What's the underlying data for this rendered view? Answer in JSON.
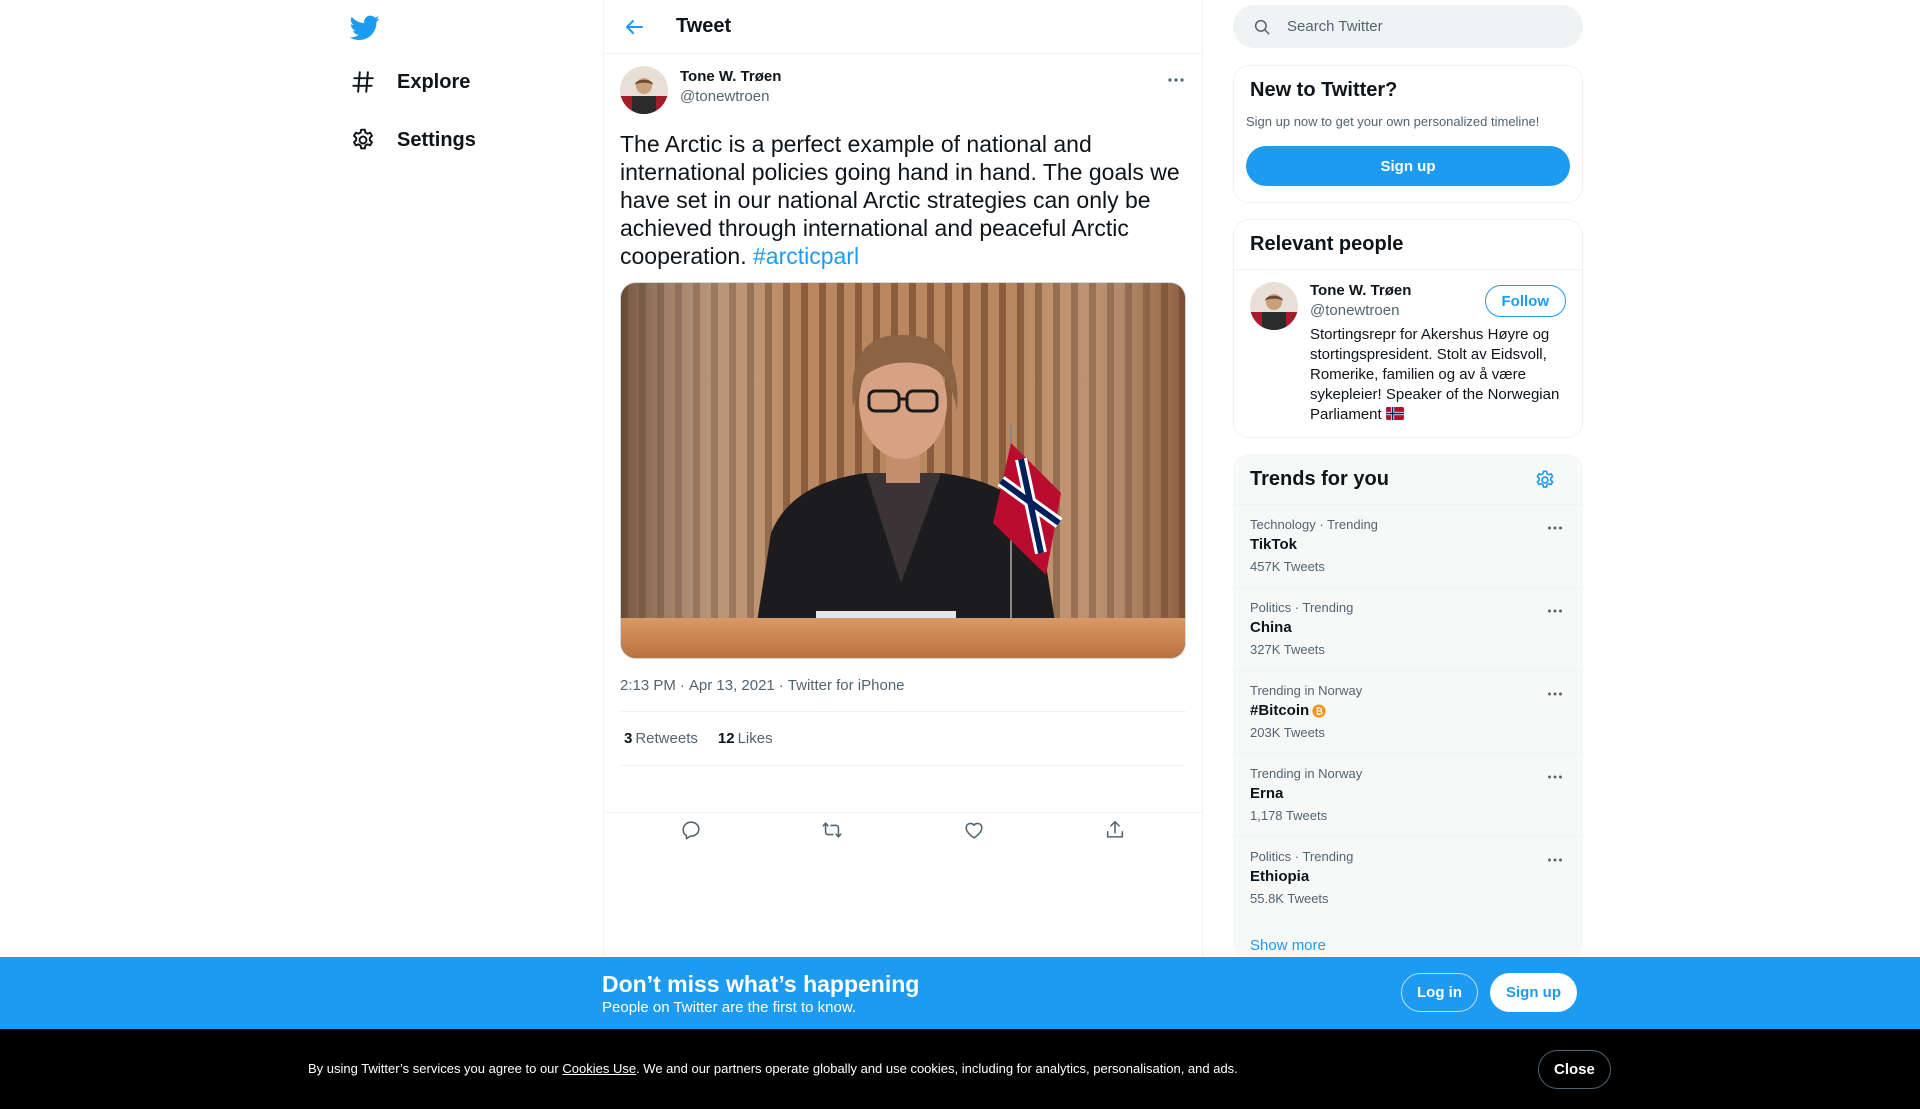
{
  "colors": {
    "accent": "#1d9bf0",
    "text": "#0f1419",
    "muted": "#536471",
    "bitcoin": "#f7931a"
  },
  "nav": {
    "logo_icon": "twitter-bird-icon",
    "items": [
      {
        "icon": "hashtag-icon",
        "label": "Explore"
      },
      {
        "icon": "gear-icon",
        "label": "Settings"
      }
    ]
  },
  "header": {
    "back_icon": "arrow-left-icon",
    "title": "Tweet"
  },
  "tweet": {
    "author_name": "Tone W. Trøen",
    "author_handle": "@tonewtroen",
    "text": "The Arctic is a perfect example of national and international policies going hand in hand. The goals we have set in our national Arctic strategies can only be achieved through international and peaceful Arctic cooperation. ",
    "hashtag": "#arcticparl",
    "time": "2:13 PM",
    "date": "Apr 13, 2021",
    "source": "Twitter for iPhone",
    "retweets_count": "3",
    "retweets_label": "Retweets",
    "likes_count": "12",
    "likes_label": "Likes",
    "action_icons": [
      "reply-icon",
      "retweet-icon",
      "like-icon",
      "share-icon"
    ]
  },
  "search": {
    "placeholder": "Search Twitter"
  },
  "new_to_twitter": {
    "title": "New to Twitter?",
    "subtext": "Sign up now to get your own personalized timeline!",
    "signup_label": "Sign up"
  },
  "relevant_people": {
    "title": "Relevant people",
    "name": "Tone W. Trøen",
    "handle": "@tonewtroen",
    "follow_label": "Follow",
    "bio": "Stortingsrepr for Akershus Høyre og stortingspresident. Stolt av Eidsvoll, Romerike, familien og av å være sykepleier! Speaker of the Norwegian Parliament "
  },
  "trends": {
    "title": "Trends for you",
    "items": [
      {
        "context": "Technology · Trending",
        "name": "TikTok",
        "count": "457K Tweets"
      },
      {
        "context": "Politics · Trending",
        "name": "China",
        "count": "327K Tweets"
      },
      {
        "context": "Trending in Norway",
        "name": "#Bitcoin",
        "count": "203K Tweets"
      },
      {
        "context": "Trending in Norway",
        "name": "Erna",
        "count": "1,178 Tweets"
      },
      {
        "context": "Politics · Trending",
        "name": "Ethiopia",
        "count": "55.8K Tweets"
      }
    ],
    "show_more": "Show more"
  },
  "banner": {
    "title": "Don’t miss what’s happening",
    "subtitle": "People on Twitter are the first to know.",
    "login_label": "Log in",
    "signup_label": "Sign up"
  },
  "cookie": {
    "text_before": "By using Twitter’s services you agree to our ",
    "link": "Cookies Use",
    "text_after": ". We and our partners operate globally and use cookies, including for analytics, personalisation, and ads.",
    "close_label": "Close"
  }
}
